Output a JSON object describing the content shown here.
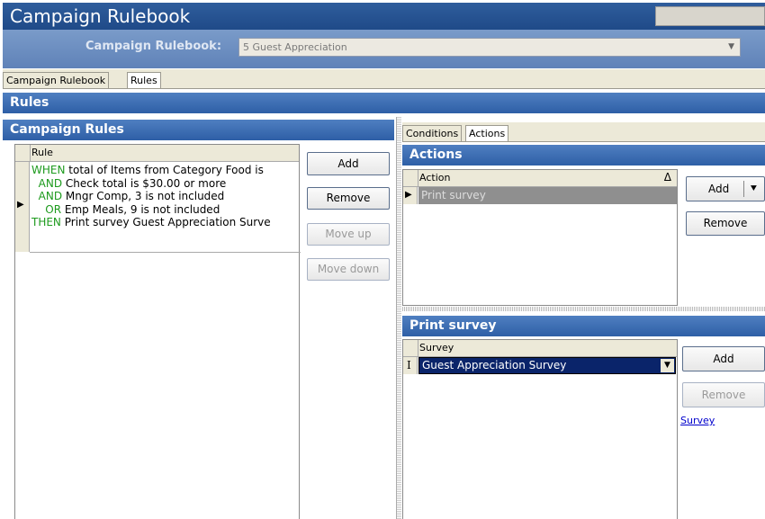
{
  "window": {
    "title": "Campaign Rulebook"
  },
  "rulebook": {
    "label": "Campaign Rulebook:",
    "value": "5 Guest Appreciation"
  },
  "tabs": [
    {
      "label": "Campaign Rulebook"
    },
    {
      "label": "Rules"
    }
  ],
  "rules_section": {
    "title": "Rules"
  },
  "campaign_rules": {
    "title": "Campaign Rules",
    "column": "Rule",
    "lines": [
      {
        "kw": "WHEN",
        "text": "total of Items from Category Food is"
      },
      {
        "kw": "AND",
        "text": "Check total is $30.00 or more"
      },
      {
        "kw": "AND",
        "text": "Mngr Comp, 3 is not included"
      },
      {
        "kw": "OR",
        "text": "Emp Meals, 9 is not included"
      },
      {
        "kw": "THEN",
        "text": "Print survey Guest Appreciation Surve"
      }
    ],
    "buttons": {
      "add": "Add",
      "remove": "Remove",
      "move_up": "Move up",
      "move_down": "Move down"
    }
  },
  "right_tabs": [
    {
      "label": "Conditions"
    },
    {
      "label": "Actions"
    }
  ],
  "actions": {
    "title": "Actions",
    "column": "Action",
    "sort_glyph": "Δ",
    "rows": [
      {
        "label": "Print survey"
      }
    ],
    "buttons": {
      "add": "Add",
      "remove": "Remove"
    }
  },
  "print_survey": {
    "title": "Print survey",
    "column": "Survey",
    "row_marker": "I",
    "selected": "Guest Appreciation Survey",
    "buttons": {
      "add": "Add",
      "remove": "Remove"
    },
    "link": "Survey"
  },
  "colors": {
    "title_bar": "#1f4a88",
    "section_bar": "#2e5fa6",
    "keyword": "#1d9a1d",
    "selected_row": "#8f8f8f",
    "link": "#0000cc"
  }
}
